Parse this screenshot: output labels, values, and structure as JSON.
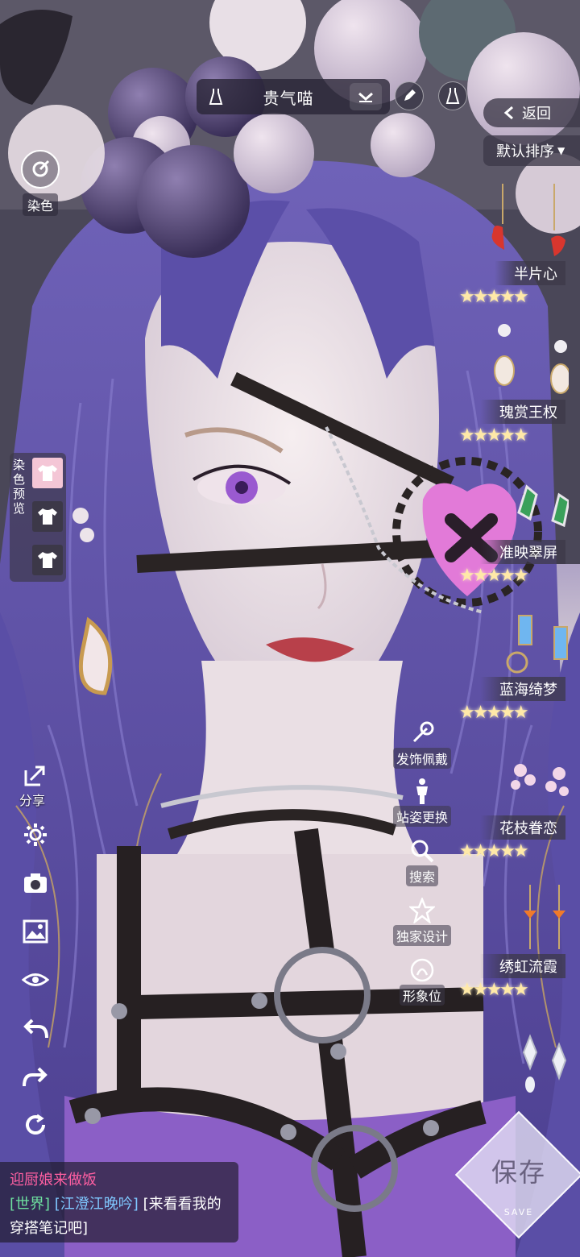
{
  "outfit_bar": {
    "outfit_name": "贵气喵"
  },
  "nav": {
    "back_label": "返回",
    "sort_label": "默认排序"
  },
  "left_panel": {
    "dye_label": "染色",
    "dye_preview_label": "染色预览",
    "share_label": "分享"
  },
  "catalog": [
    {
      "name": "半片心",
      "stars": "★★★★★"
    },
    {
      "name": "瑰赏王权",
      "stars": "★★★★★"
    },
    {
      "name": "准映翠屏",
      "stars": "★★★★★"
    },
    {
      "name": "蓝海绮梦",
      "stars": "★★★★★"
    },
    {
      "name": "花枝眷恋",
      "stars": "★★★★★"
    },
    {
      "name": "绣虹流霞",
      "stars": "★★★★★"
    }
  ],
  "functions": {
    "accessory": "发饰佩戴",
    "pose": "站姿更换",
    "search": "搜索",
    "exclusive": "独家设计",
    "image": "形象位"
  },
  "save": {
    "label": "保存",
    "sub": "SAVE"
  },
  "chat": {
    "system": "迎厨娘来做饭",
    "channel": "[世界]",
    "user": "[江澄江晚吟]",
    "message": "[来看看我的穿搭笔记吧]"
  },
  "colors": {
    "accent_pink": "#ff5fa2",
    "hair_purple": "#7d6fb3",
    "panel": "#3c3848"
  }
}
